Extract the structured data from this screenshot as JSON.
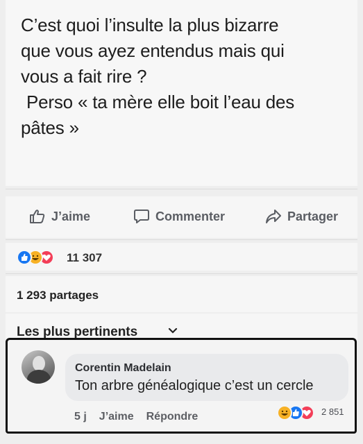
{
  "post": {
    "lines": [
      "C’est quoi l’insulte la plus bizarre",
      "que vous ayez entendus mais qui",
      "vous a fait rire ?",
      "Perso « ta mère elle boit l’eau des",
      "pâtes »"
    ]
  },
  "actions": {
    "like_label": "J’aime",
    "comment_label": "Commenter",
    "share_label": "Partager"
  },
  "reactions": {
    "types": [
      "like",
      "haha",
      "love"
    ],
    "count": "11 307"
  },
  "shares": {
    "label": "1 293 partages"
  },
  "sort": {
    "label": "Les plus pertinents"
  },
  "comment": {
    "author": "Corentin Madelain",
    "text": "Ton arbre généalogique c’est un cercle",
    "time": "5 j",
    "like_label": "J’aime",
    "reply_label": "Répondre",
    "reaction_types": [
      "haha",
      "like",
      "love"
    ],
    "reaction_count": "2 851"
  },
  "colors": {
    "like_blue": "#1877f2",
    "love_red": "#f33e58",
    "haha_yellow": "#f7b125",
    "outline": "#111111"
  }
}
